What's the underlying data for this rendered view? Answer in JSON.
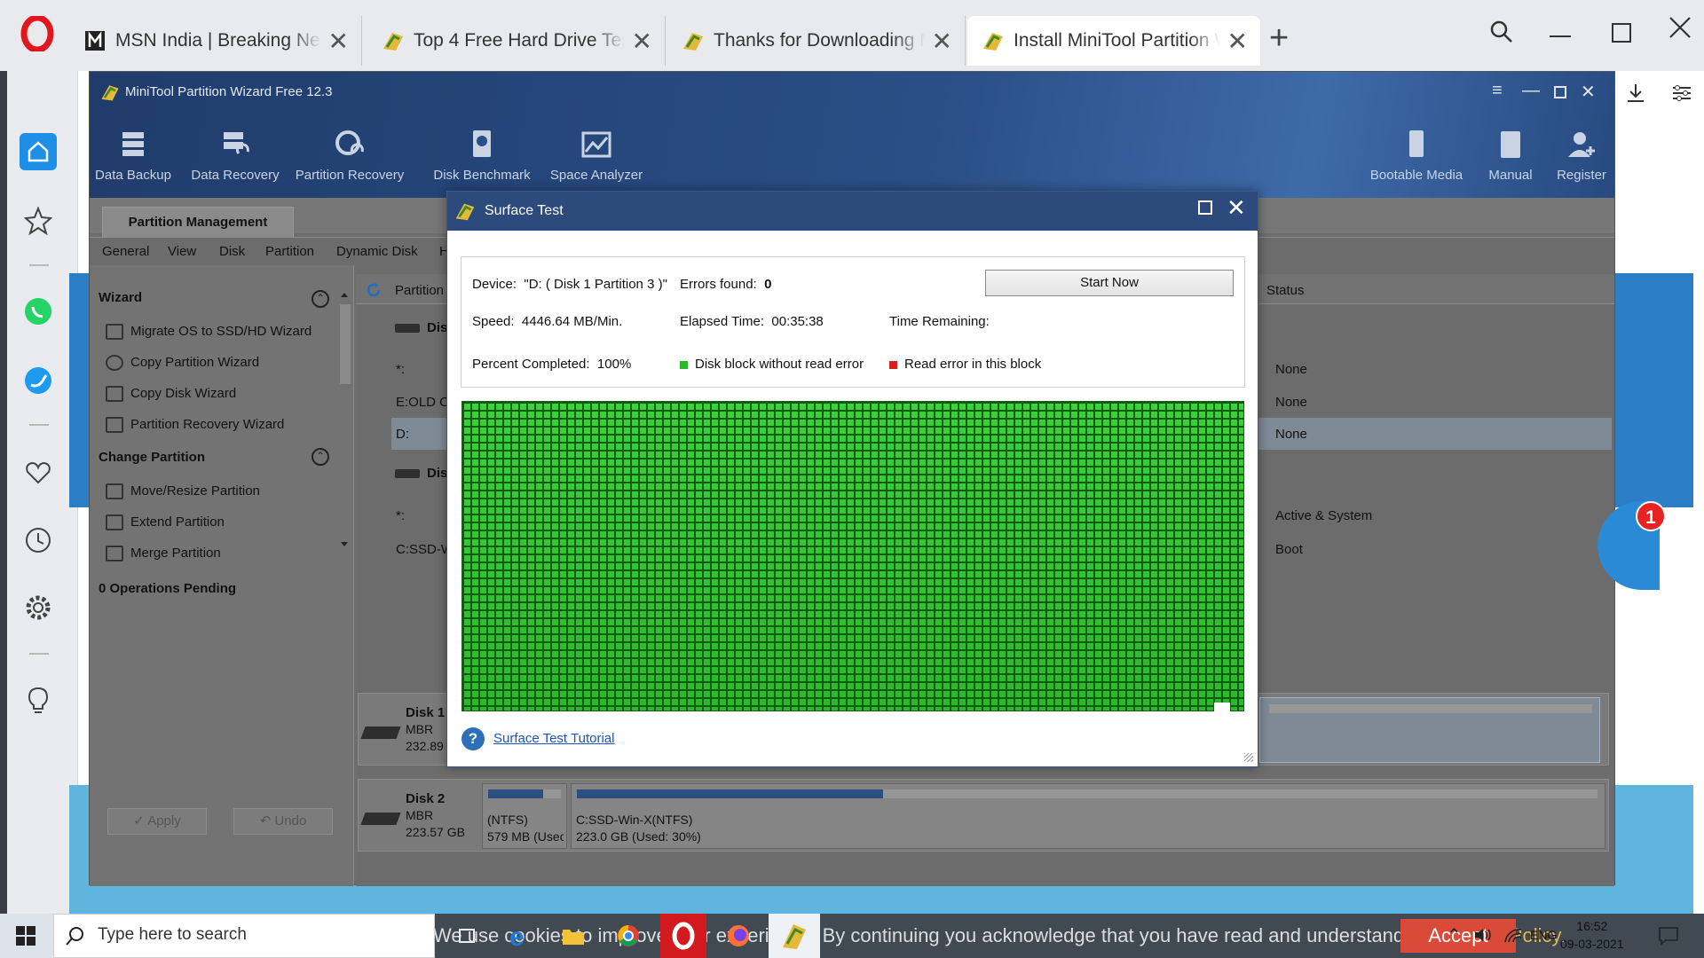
{
  "browser": {
    "tabs": [
      {
        "label": "MSN India | Breaking News",
        "icon": "msn-icon",
        "active": false
      },
      {
        "label": "Top 4 Free Hard Drive Test",
        "icon": "minitool-icon",
        "active": false
      },
      {
        "label": "Thanks for Downloading M",
        "icon": "minitool-icon",
        "active": false
      },
      {
        "label": "Install MiniTool Partition W",
        "icon": "minitool-icon",
        "active": true
      }
    ],
    "close_glyph": "✕",
    "new_tab": "+",
    "sidebar_icons": [
      "home-icon",
      "bookmark-icon",
      "whatsapp-icon",
      "twitter-icon",
      "heart-icon",
      "history-icon",
      "settings-icon",
      "bulb-icon"
    ]
  },
  "app": {
    "title": "MiniTool Partition Wizard Free 12.3",
    "toolbar": [
      "Data Backup",
      "Data Recovery",
      "Partition Recovery",
      "Disk Benchmark",
      "Space Analyzer"
    ],
    "toolbar_right": [
      "Bootable Media",
      "Manual",
      "Register"
    ],
    "tab": "Partition Management",
    "menu": [
      "General",
      "View",
      "Disk",
      "Partition",
      "Dynamic Disk",
      "H"
    ],
    "wizard": {
      "heading": "Wizard",
      "items": [
        "Migrate OS to SSD/HD Wizard",
        "Copy Partition Wizard",
        "Copy Disk Wizard",
        "Partition Recovery Wizard"
      ]
    },
    "change": {
      "heading": "Change Partition",
      "items": [
        "Move/Resize Partition",
        "Extend Partition",
        "Merge Partition"
      ]
    },
    "pending": "0 Operations Pending",
    "apply": "✓ Apply",
    "undo": "↶ Undo",
    "columns": {
      "partition": "Partition",
      "status": "Status"
    },
    "rows": [
      {
        "name": "Dis",
        "status": ""
      },
      {
        "name": "*:",
        "status": "None"
      },
      {
        "name": "E:OLD C",
        "status": "None"
      },
      {
        "name": "D:",
        "status": "None"
      },
      {
        "name": "Dis",
        "status": ""
      },
      {
        "name": "*:",
        "status": "Active & System"
      },
      {
        "name": "C:SSD-W",
        "status": "Boot"
      }
    ],
    "disk1": {
      "name": "Disk 1",
      "type": "MBR",
      "size": "232.89"
    },
    "disk2": {
      "name": "Disk 2",
      "type": "MBR",
      "size": "223.57 GB",
      "p1_label": "(NTFS)",
      "p1_size": "579 MB (Usec",
      "p2_label": "C:SSD-Win-X(NTFS)",
      "p2_size": "223.0 GB (Used: 30%)",
      "p1_used": 0.75,
      "p2_used": 0.3
    }
  },
  "dialog": {
    "title": "Surface Test",
    "device_label": "Device:",
    "device": "\"D: ( Disk 1 Partition 3 )\"",
    "errors_label": "Errors found:",
    "errors": "0",
    "start_button": "Start Now",
    "speed_label": "Speed:",
    "speed": "4446.64 MB/Min.",
    "elapsed_label": "Elapsed Time:",
    "elapsed": "00:35:38",
    "remaining_label": "Time Remaining:",
    "remaining": "",
    "percent_label": "Percent Completed:",
    "percent": "100%",
    "legend_ok": "Disk block without read error",
    "legend_err": "Read error in this block",
    "color_ok": "#2cb82c",
    "color_err": "#d32020",
    "tutorial": "Surface Test Tutorial"
  },
  "chat_badge": "1",
  "taskbar": {
    "search_placeholder": "Type here to search",
    "cookie_text_a": "We use cookies to improve your experience. By continuing you acknowledge that you have read and understand our ",
    "cookie_link": "Cookie Policy.",
    "accept": "Accept",
    "lang": "ENG",
    "time": "16:52",
    "date": "09-03-2021"
  }
}
